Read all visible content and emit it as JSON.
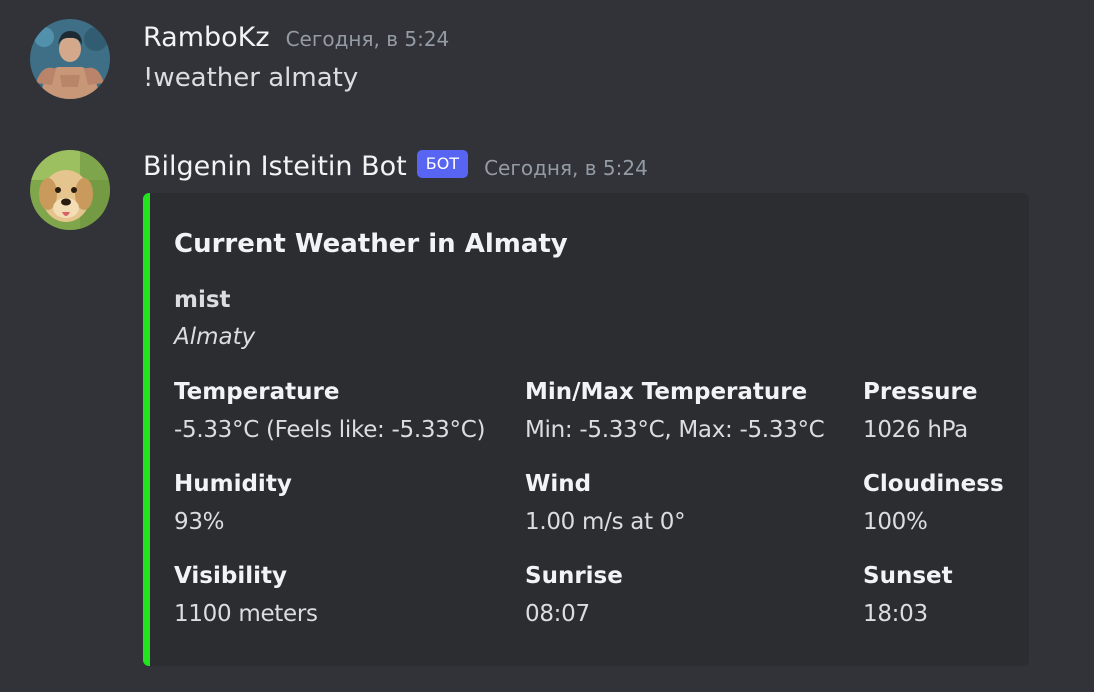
{
  "messages": [
    {
      "username": "RamboKz",
      "timestamp": "Сегодня, в 5:24",
      "content": "!weather almaty"
    },
    {
      "username": "Bilgenin Isteitin Bot",
      "bot_tag": "БОТ",
      "timestamp": "Сегодня, в 5:24"
    }
  ],
  "embed": {
    "accent_color": "#22e51f",
    "title": "Current Weather in Almaty",
    "description_bold": "mist",
    "description_italic": "Almaty",
    "fields": [
      {
        "name": "Temperature",
        "value": "-5.33°C (Feels like: -5.33°C)"
      },
      {
        "name": "Min/Max Temperature",
        "value": "Min: -5.33°C, Max: -5.33°C"
      },
      {
        "name": "Pressure",
        "value": "1026 hPa"
      },
      {
        "name": "Humidity",
        "value": "93%"
      },
      {
        "name": "Wind",
        "value": "1.00 m/s at 0°"
      },
      {
        "name": "Cloudiness",
        "value": "100%"
      },
      {
        "name": "Visibility",
        "value": "1100 meters"
      },
      {
        "name": "Sunrise",
        "value": "08:07"
      },
      {
        "name": "Sunset",
        "value": "18:03"
      }
    ]
  }
}
